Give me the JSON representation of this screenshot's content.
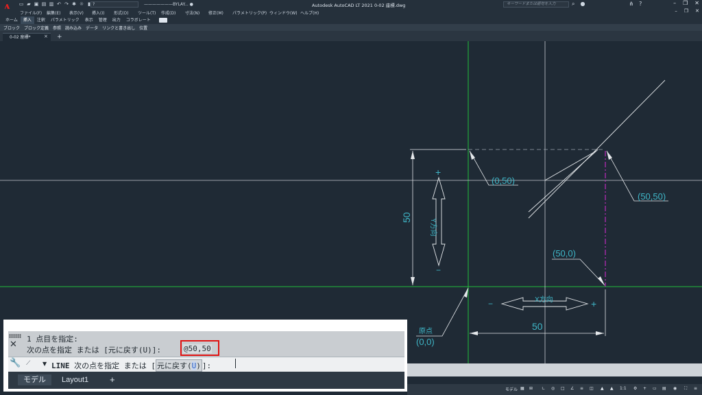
{
  "app": {
    "logo": "A",
    "title": "Autodesk AutoCAD LT 2021    0-02 座標.dwg",
    "search_placeholder": "キーワードまたは語句を入力",
    "layer_value": "?",
    "linetype_value": "BYLAY..."
  },
  "menu": [
    "ファイル(F)",
    "編集(E)",
    "表示(V)",
    "挿入(I)",
    "形式(O)",
    "ツール(T)",
    "作成(D)",
    "寸法(N)",
    "修正(M)",
    "パラメトリック(P)",
    "ウィンドウ(W)",
    "ヘルプ(H)"
  ],
  "ribbon_tabs": [
    "ホーム",
    "挿入",
    "注釈",
    "パラメトリック",
    "表示",
    "管理",
    "出力",
    "コラボレート"
  ],
  "ribbon_active_tab": "挿入",
  "ribbon_panels": [
    "ブロック",
    "ブロック定義",
    "参照",
    "読み込み",
    "データ",
    "リンクと書き出し",
    "位置"
  ],
  "file_tab": {
    "label": "0-02 座標*",
    "close": "×",
    "add": "+"
  },
  "drawing": {
    "label_origin_title": "原点",
    "label_origin": "(0,0)",
    "label_0_50": "(0,50)",
    "label_50_50": "(50,50)",
    "label_50_0": "(50,0)",
    "dim_vertical": "50",
    "dim_horizontal": "50",
    "y_direction": "Y方向",
    "x_direction": "X方向",
    "plus": "+",
    "minus": "−",
    "colors": {
      "axis_green": "#22c03a",
      "crosshair": "#c8cdd2",
      "cad_text": "#3fb6c7",
      "magenta": "#c02ac0",
      "white_line": "#e6e9ec"
    }
  },
  "command": {
    "history_1": "1 点目を指定:",
    "history_2_prefix": "次の点を指定 または [元に戻す(U)]: ",
    "history_2_value": "@50,50",
    "prompt_command": "LINE",
    "prompt_text": " 次の点を指定 または [",
    "prompt_option": "元に戻す(",
    "prompt_option_key": "U",
    "prompt_option_close": ")",
    "prompt_end": "]:",
    "highlight_color": "#e01010"
  },
  "layout_tabs": {
    "model": "モデル",
    "layout1": "Layout1",
    "add": "+"
  },
  "status": {
    "model": "モデル",
    "scale": "1:1"
  }
}
